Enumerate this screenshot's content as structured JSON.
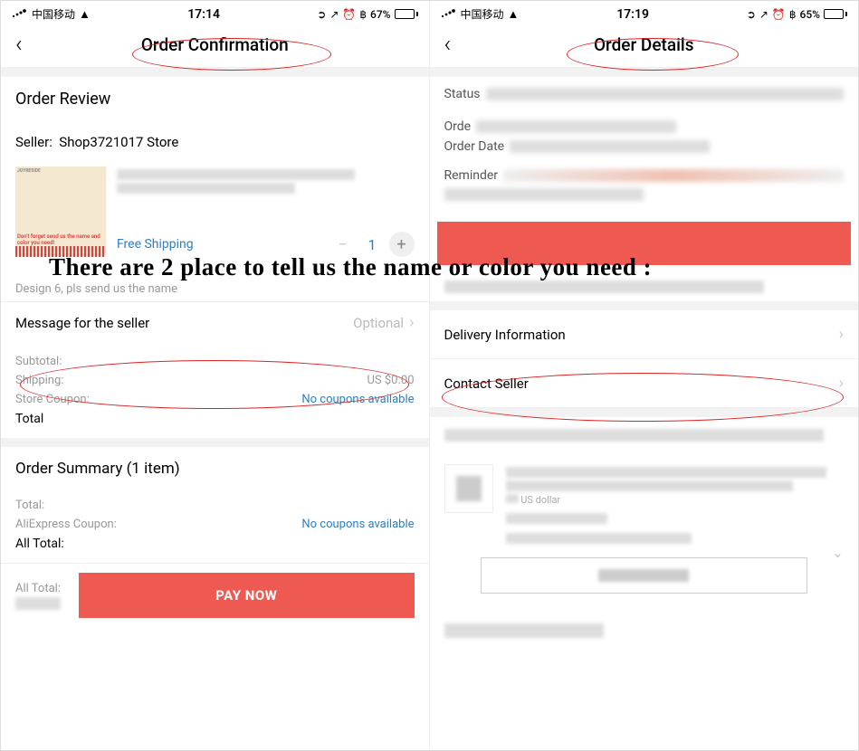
{
  "left": {
    "status": {
      "carrier": "中国移动",
      "time": "17:14",
      "battery_pct": "67%"
    },
    "nav_title": "Order Confirmation",
    "review_title": "Order Review",
    "seller_label": "Seller:",
    "seller_name": "Shop3721017 Store",
    "thumb_brand": "JOYRESIDE",
    "thumb_note": "Don't forget send us the name and color you need!",
    "free_shipping": "Free Shipping",
    "qty": "1",
    "variant_text": "Design 6, pls send us the name",
    "msg_seller": "Message for the seller",
    "msg_seller_hint": "Optional",
    "totals": {
      "subtotal_label": "Subtotal:",
      "shipping_label": "Shipping:",
      "shipping_val": "US $0.00",
      "coupon_label": "Store Coupon:",
      "coupon_val": "No coupons available",
      "total_label": "Total"
    },
    "summary_title": "Order Summary (1 item)",
    "summary": {
      "total_label": "Total:",
      "ali_coupon_label": "AliExpress Coupon:",
      "ali_coupon_val": "No coupons available",
      "all_total_label": "All Total:"
    },
    "pay": {
      "all_total_label": "All Total:",
      "btn": "PAY NOW"
    }
  },
  "right": {
    "status": {
      "carrier": "中国移动",
      "time": "17:19",
      "battery_pct": "65%"
    },
    "nav_title": "Order Details",
    "status_label": "Status",
    "order_label": "Orde",
    "order_date_label": "Order Date",
    "reminder_label": "Reminder",
    "delivery": "Delivery Information",
    "contact": "Contact Seller",
    "currency_hint": "US dollar"
  },
  "overlay": "There are 2 place to tell us the name or color you need :"
}
